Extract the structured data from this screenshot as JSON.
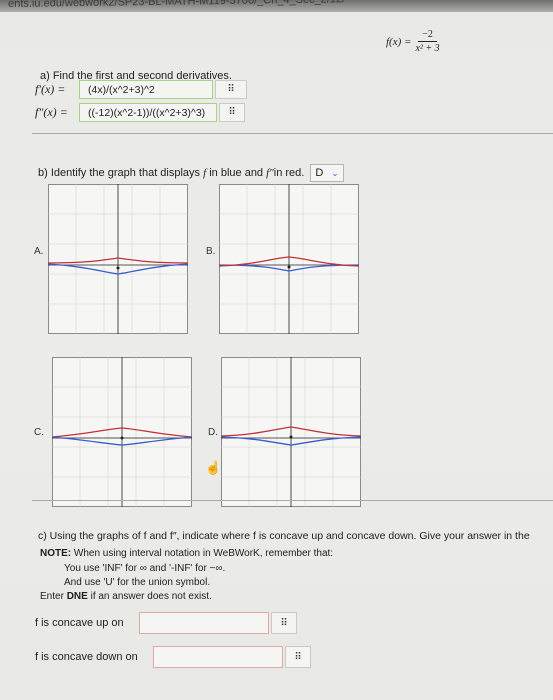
{
  "topbar": {
    "url_text": "ents.iu.edu/webwork2/SP23-BL-MATH-M119-5706/_Ch_4_Sec_2/12/"
  },
  "function_def": {
    "lhs": "f(x) =",
    "numerator": "−2",
    "denominator": "x² + 3"
  },
  "part_a": {
    "prompt": "a) Find the first and second derivatives.",
    "first_label": "f′(x) =",
    "first_answer": "(4x)/(x^2+3)^2",
    "second_label": "f″(x) =",
    "second_answer": "((-12)(x^2-1))/((x^2+3)^3)",
    "keyboard_icon": "⠿"
  },
  "part_b": {
    "prompt_start": "b) Identify the graph that displays ",
    "f1": "f",
    "prompt_mid": " in blue and ",
    "f2": "f″",
    "prompt_end": " in red.",
    "selected": "D",
    "chevron": "⌄"
  },
  "graphs": [
    {
      "label": "A.",
      "blue_color": "#3b5bd1",
      "red_color": "#c0303a"
    },
    {
      "label": "B.",
      "blue_color": "#3b5bd1",
      "red_color": "#c0303a"
    },
    {
      "label": "C.",
      "blue_color": "#3b5bd1",
      "red_color": "#c0303a"
    },
    {
      "label": "D.",
      "blue_color": "#3b5bd1",
      "red_color": "#c0303a"
    }
  ],
  "cursor_icon": "☝",
  "part_c": {
    "prompt": "c) Using the graphs of f and f″, indicate where f is concave up and concave down. Give your answer in the",
    "note_label": "NOTE:",
    "note_text": " When using interval notation in WeBWorK, remember that:",
    "line1": "You use 'INF' for ∞ and '-INF' for −∞.",
    "line2": "And use 'U' for the union symbol.",
    "line3_pre": "Enter ",
    "line3_bold": "DNE",
    "line3_post": " if an answer does not exist.",
    "concave_up_label": "f is concave up on",
    "concave_down_label": "f is concave down on",
    "concave_up_value": "",
    "concave_down_value": ""
  }
}
